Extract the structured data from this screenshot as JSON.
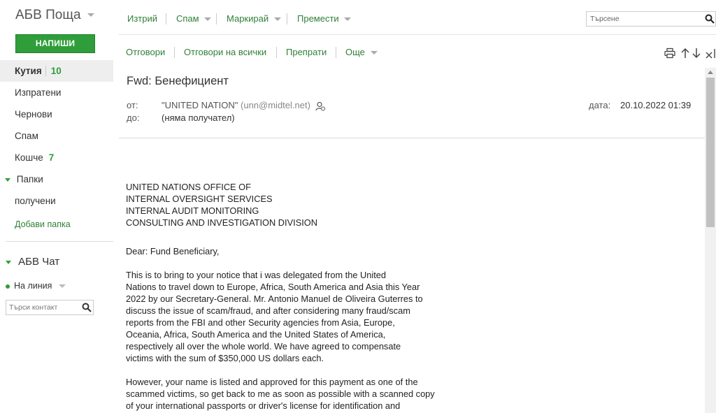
{
  "sidebar": {
    "brand": "АБВ Поща",
    "compose_label": "НАПИШИ",
    "folders": [
      {
        "label": "Кутия",
        "count": "10"
      },
      {
        "label": "Изпратени"
      },
      {
        "label": "Чернови"
      },
      {
        "label": "Спам"
      },
      {
        "label": "Кошче",
        "count": "7"
      },
      {
        "label": "Папки"
      },
      {
        "label": "получени"
      },
      {
        "label": "Добави папка"
      }
    ],
    "chat_title": "АБВ Чат",
    "status": "На линия",
    "contact_search_placeholder": "Търси контакт"
  },
  "toolbar": {
    "delete": "Изтрий",
    "spam": "Спам",
    "mark": "Маркирай",
    "move": "Премести",
    "search_placeholder": "Търсене"
  },
  "message_toolbar": {
    "reply": "Отговори",
    "reply_all": "Отговори на всички",
    "forward": "Препрати",
    "more": "Още"
  },
  "message": {
    "subject": "Fwd: Бенефициент",
    "from_label": "от:",
    "from_name": "\"UNITED NATION\"",
    "from_email": "(unn@midtel.net)",
    "to_label": "до:",
    "to_value": "(няма получател)",
    "date_label": "дата:",
    "date_value": "20.10.2022 01:39",
    "body": {
      "heading_lines": [
        "UNITED NATIONS OFFICE OF",
        "INTERNAL OVERSIGHT SERVICES",
        "INTERNAL AUDIT MONITORING",
        "CONSULTING AND INVESTIGATION DIVISION"
      ],
      "greeting": "Dear: Fund Beneficiary,",
      "paragraph1": [
        "This is to bring to your notice that i was delegated from the United",
        "Nations to travel down to Europe, Africa, South America and Asia this Year",
        "2022 by our Secretary-General. Mr. Antonio Manuel de Oliveira Guterres to",
        "discuss the issue of scam/fraud, and after considering many fraud/scam",
        "reports from the FBI and other Security agencies from Asia, Europe,",
        "Oceania, Africa, South America and the United States of America,",
        "respectively all over the whole world. We have agreed to compensate",
        "victims with the sum of $350,000 US dollars each."
      ],
      "paragraph2": [
        "However, your name is listed and approved for this payment as one of the",
        "scammed victims, so get back to me as soon as possible with a scanned copy",
        "of your international passports or driver's license for identification and"
      ]
    }
  },
  "colors": {
    "accent": "#2f9e3a",
    "link": "#2f7f36"
  }
}
